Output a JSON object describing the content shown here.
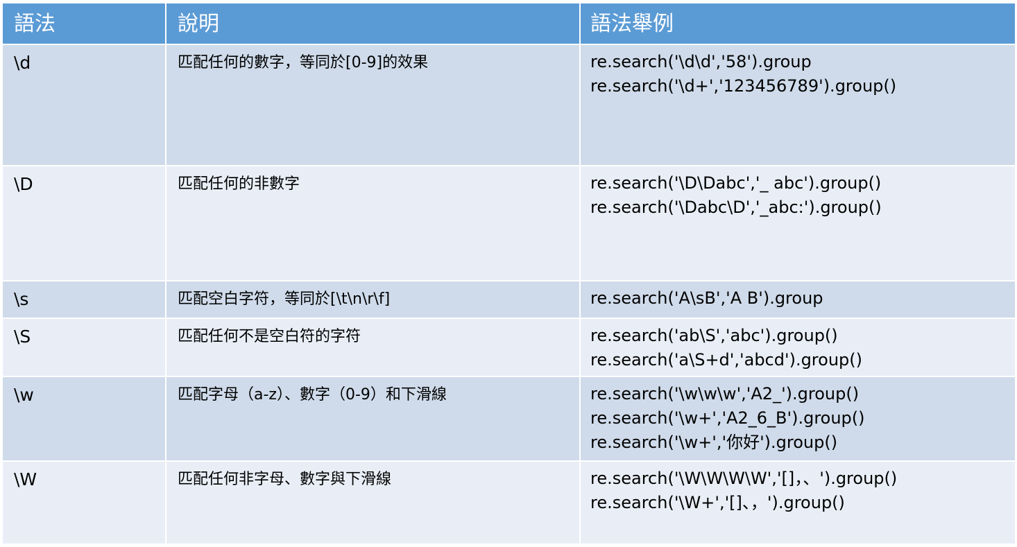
{
  "colors": {
    "header_bg": "#5b9bd5",
    "row_odd": "#cfdbea",
    "row_even": "#e9eef6"
  },
  "headers": [
    "語法",
    "說明",
    "語法舉例"
  ],
  "rows": [
    {
      "syntax": "\\d",
      "description": "匹配任何的數字，等同於[0-9]的效果",
      "examples": [
        "re.search('\\d\\d','58').group",
        "re.search('\\d+','123456789').group()"
      ]
    },
    {
      "syntax": "\\D",
      "description": "匹配任何的非數字",
      "examples": [
        "re.search('\\D\\Dabc','_ abc').group()",
        "re.search('\\Dabc\\D','_abc:').group()"
      ]
    },
    {
      "syntax": "\\s",
      "description": "匹配空白字符，等同於[\\t\\n\\r\\f]",
      "examples": [
        "re.search('A\\sB','A B').group"
      ]
    },
    {
      "syntax": "\\S",
      "description": "匹配任何不是空白符的字符",
      "examples": [
        "re.search('ab\\S','abc').group()",
        "re.search('a\\S+d','abcd').group()"
      ]
    },
    {
      "syntax": "\\w",
      "description": "匹配字母（a-z）、數字（0-9）和下滑線",
      "examples": [
        "re.search('\\w\\w\\w','A2_').group()",
        "re.search('\\w+','A2_6_B').group()",
        "re.search('\\w+','你好').group()"
      ]
    },
    {
      "syntax": "\\W",
      "description": "匹配任何非字母、數字與下滑線",
      "examples": [
        "re.search('\\W\\W\\W\\W','[]，、').group()",
        "re.search('\\W+','[]、，').group()"
      ]
    }
  ]
}
